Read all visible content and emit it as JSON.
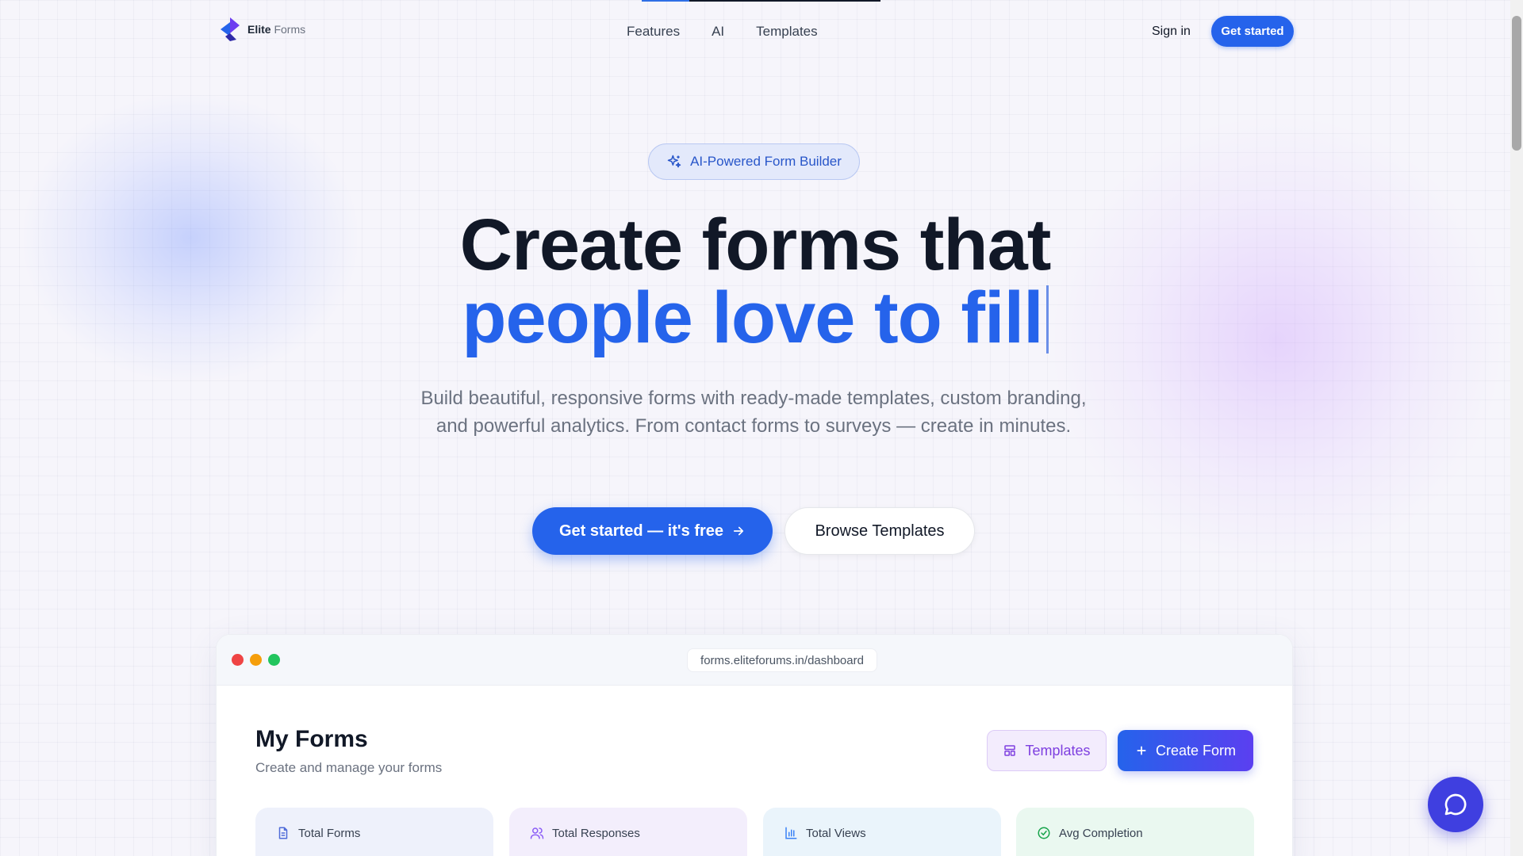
{
  "nav": {
    "logo_bold": "Elite",
    "logo_light": "Forms",
    "links": [
      "Features",
      "AI",
      "Templates"
    ],
    "sign_in": "Sign in",
    "get_started": "Get started"
  },
  "hero": {
    "badge": "AI-Powered Form Builder",
    "title_line1": "Create forms that",
    "title_line2": "people love to fill",
    "subtitle": "Build beautiful, responsive forms with ready-made templates, custom branding, and powerful analytics. From contact forms to surveys — create in minutes.",
    "cta_primary": "Get started — it's free",
    "cta_secondary": "Browse Templates"
  },
  "preview": {
    "url": "forms.eliteforums.in/dashboard",
    "title": "My Forms",
    "subtitle": "Create and manage your forms",
    "templates_button": "Templates",
    "create_button": "Create Form",
    "stats": [
      {
        "label": "Total Forms",
        "icon": "document-icon",
        "bg": "#eef1fb"
      },
      {
        "label": "Total Responses",
        "icon": "users-icon",
        "bg": "#f3eefc"
      },
      {
        "label": "Total Views",
        "icon": "bar-chart-icon",
        "bg": "#eaf4fb"
      },
      {
        "label": "Avg Completion",
        "icon": "check-circle-icon",
        "bg": "#eaf8f0"
      }
    ]
  },
  "colors": {
    "accent": "#2563eb",
    "purple": "#7e3fe0",
    "traffic_red": "#ef4444",
    "traffic_yellow": "#f59e0b",
    "traffic_green": "#22c55e"
  }
}
